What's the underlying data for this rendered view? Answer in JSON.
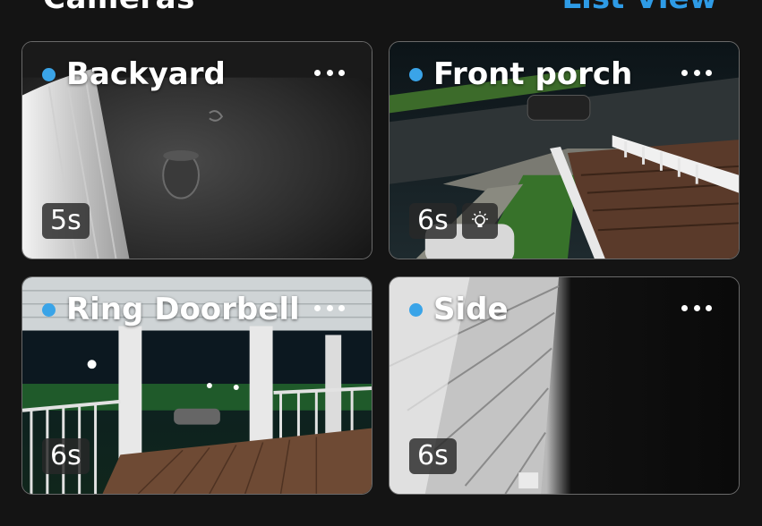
{
  "header": {
    "title": "Cameras",
    "view_toggle": "List View"
  },
  "accent": "#3aa4e8",
  "cameras": [
    {
      "name": "Backyard",
      "age": "5s",
      "status_color": "#3aa4e8",
      "light_icon": false,
      "more_icon": "more-horizontal-icon"
    },
    {
      "name": "Front porch",
      "age": "6s",
      "status_color": "#3aa4e8",
      "light_icon": true,
      "more_icon": "more-horizontal-icon"
    },
    {
      "name": "Ring Doorbell",
      "age": "6s",
      "status_color": "#3aa4e8",
      "light_icon": false,
      "more_icon": "more-horizontal-icon"
    },
    {
      "name": "Side",
      "age": "6s",
      "status_color": "#3aa4e8",
      "light_icon": false,
      "more_icon": "more-horizontal-icon"
    }
  ]
}
